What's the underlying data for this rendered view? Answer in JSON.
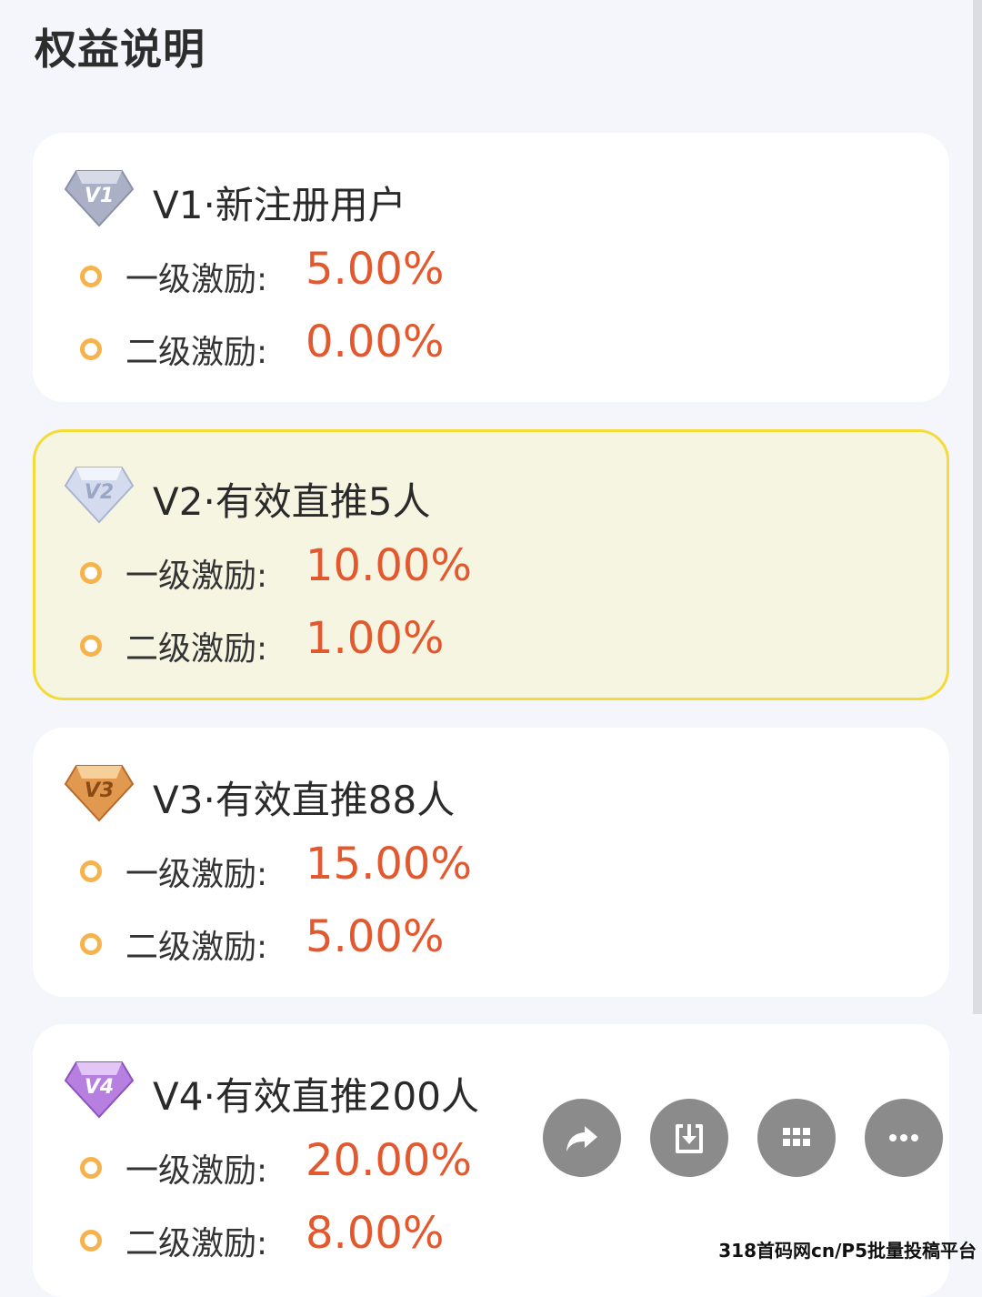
{
  "page": {
    "title": "权益说明"
  },
  "levels": [
    {
      "title": "V1·新注册用户",
      "badge_text": "V1",
      "badge_color": "#9ea6bd",
      "rows": [
        {
          "label": "一级激励:",
          "value": "5.00%"
        },
        {
          "label": "二级激励:",
          "value": "0.00%"
        }
      ]
    },
    {
      "title": "V2·有效直推5人",
      "badge_text": "V2",
      "badge_color": "#c9d2e8",
      "rows": [
        {
          "label": "一级激励:",
          "value": "10.00%"
        },
        {
          "label": "二级激励:",
          "value": "1.00%"
        }
      ]
    },
    {
      "title": "V3·有效直推88人",
      "badge_text": "V3",
      "badge_color": "#d9893e",
      "rows": [
        {
          "label": "一级激励:",
          "value": "15.00%"
        },
        {
          "label": "二级激励:",
          "value": "5.00%"
        }
      ]
    },
    {
      "title": "V4·有效直推200人",
      "badge_text": "V4",
      "badge_color": "#b478df",
      "rows": [
        {
          "label": "一级激励:",
          "value": "20.00%"
        },
        {
          "label": "二级激励:",
          "value": "8.00%"
        }
      ]
    }
  ],
  "selected_level": "V2",
  "colors": {
    "accent_value": "#e2582f",
    "bullet": "#f6b24c",
    "active_border": "#f4db3a",
    "active_bg": "#f5f5e2"
  },
  "floating_actions": [
    {
      "icon": "share-icon"
    },
    {
      "icon": "download-icon"
    },
    {
      "icon": "grid-icon"
    },
    {
      "icon": "more-icon"
    }
  ],
  "watermark": "318首码网cn/P5批量投稿平台"
}
